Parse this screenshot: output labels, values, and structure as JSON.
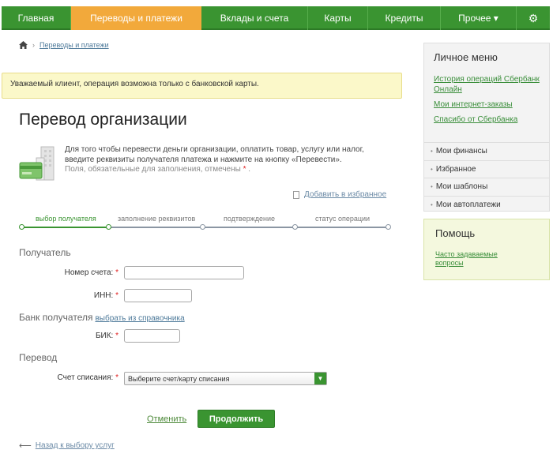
{
  "nav": {
    "items": [
      {
        "label": "Главная"
      },
      {
        "label": "Переводы и платежи"
      },
      {
        "label": "Вклады и счета"
      },
      {
        "label": "Карты"
      },
      {
        "label": "Кредиты"
      },
      {
        "label": "Прочее ▾"
      }
    ],
    "active_index": 1,
    "settings_icon": "gear-icon"
  },
  "breadcrumb": {
    "home_icon": "home-icon",
    "separator": "›",
    "current": "Переводы и платежи"
  },
  "notice": {
    "text": "Уважаемый клиент, операция возможна только с банковской карты."
  },
  "page": {
    "title": "Перевод организации",
    "intro": "Для того чтобы перевести деньги организации, оплатить товар, услугу или налог, введите реквизиты получателя платежа и нажмите на кнопку «Перевести».",
    "required_note": "Поля, обязательные для заполнения, отмечены",
    "required_star": "*",
    "required_end": ".",
    "add_favorite": "Добавить в избранное"
  },
  "steps": [
    {
      "label": "выбор получателя",
      "current": true
    },
    {
      "label": "заполнение реквизитов",
      "current": false
    },
    {
      "label": "подтверждение",
      "current": false
    },
    {
      "label": "статус операции",
      "current": false
    }
  ],
  "form": {
    "recipient_section": "Получатель",
    "account_label": "Номер счета:",
    "inn_label": "ИНН:",
    "bank_section": "Банк получателя",
    "bank_directory_link": "выбрать из справочника",
    "bik_label": "БИК:",
    "transfer_section": "Перевод",
    "debit_label": "Счет списания:",
    "debit_select": "Выберите счет/карту списания",
    "star": "*"
  },
  "actions": {
    "cancel": "Отменить",
    "continue": "Продолжить",
    "back": "Назад к выбору услуг"
  },
  "sidebar": {
    "personal_title": "Личное меню",
    "links": [
      "История операций Сбербанк Онлайн",
      "Мои интернет-заказы",
      "Спасибо от Сбербанка"
    ],
    "menu": [
      "Мои финансы",
      "Избранное",
      "Мои шаблоны",
      "Мои автоплатежи"
    ],
    "help_title": "Помощь",
    "help_link": "Часто задаваемые вопросы"
  },
  "colors": {
    "brand_green": "#3a9431",
    "active_tab": "#f2a93b",
    "notice_bg": "#fbf8c9"
  }
}
